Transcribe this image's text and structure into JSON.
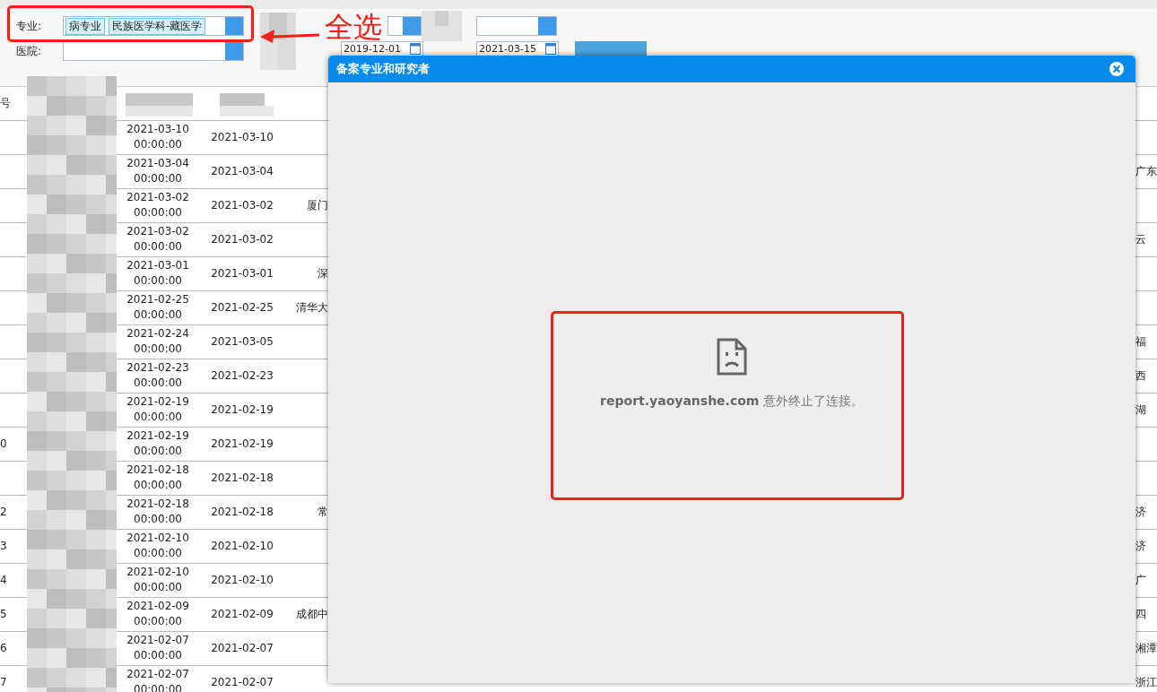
{
  "filters": {
    "major_label": "专业:",
    "major_tags": [
      "病专业",
      "民族医学科-藏医学"
    ],
    "hospital_label": "医院:",
    "date_from": "2019-12-01",
    "date_to": "2021-03-15"
  },
  "annotation": {
    "text": "全选"
  },
  "table": {
    "header_cell": "号",
    "rows": [
      {
        "index": "",
        "created": "2021-03-10 00:00:00",
        "date": "2021-03-10",
        "institution": "",
        "region": ""
      },
      {
        "index": "",
        "created": "2021-03-04 00:00:00",
        "date": "2021-03-04",
        "institution": "",
        "region": "广东"
      },
      {
        "index": "",
        "created": "2021-03-02 00:00:00",
        "date": "2021-03-02",
        "institution": "厦门",
        "region": ""
      },
      {
        "index": "",
        "created": "2021-03-02 00:00:00",
        "date": "2021-03-02",
        "institution": "",
        "region": "云"
      },
      {
        "index": "",
        "created": "2021-03-01 00:00:00",
        "date": "2021-03-01",
        "institution": "深",
        "region": ""
      },
      {
        "index": "",
        "created": "2021-02-25 00:00:00",
        "date": "2021-02-25",
        "institution": "清华大",
        "region": ""
      },
      {
        "index": "",
        "created": "2021-02-24 00:00:00",
        "date": "2021-03-05",
        "institution": "",
        "region": "福"
      },
      {
        "index": "",
        "created": "2021-02-23 00:00:00",
        "date": "2021-02-23",
        "institution": "",
        "region": "西"
      },
      {
        "index": "",
        "created": "2021-02-19 00:00:00",
        "date": "2021-02-19",
        "institution": "",
        "region": "湖"
      },
      {
        "index": "0",
        "created": "2021-02-19 00:00:00",
        "date": "2021-02-19",
        "institution": "",
        "region": ""
      },
      {
        "index": "",
        "created": "2021-02-18 00:00:00",
        "date": "2021-02-18",
        "institution": "",
        "region": ""
      },
      {
        "index": "2",
        "created": "2021-02-18 00:00:00",
        "date": "2021-02-18",
        "institution": "常",
        "region": "济"
      },
      {
        "index": "3",
        "created": "2021-02-10 00:00:00",
        "date": "2021-02-10",
        "institution": "",
        "region": "济"
      },
      {
        "index": "4",
        "created": "2021-02-10 00:00:00",
        "date": "2021-02-10",
        "institution": "",
        "region": "广"
      },
      {
        "index": "5",
        "created": "2021-02-09 00:00:00",
        "date": "2021-02-09",
        "institution": "成都中",
        "region": "四"
      },
      {
        "index": "6",
        "created": "2021-02-07 00:00:00",
        "date": "2021-02-07",
        "institution": "",
        "region": "湘潭"
      },
      {
        "index": "7",
        "created": "2021-02-07 00:00:00",
        "date": "2021-02-07",
        "institution": "",
        "region": "浙江"
      }
    ]
  },
  "dialog": {
    "title": "备案专业和研究者",
    "error_message": "**report.yaoyanshe.com** 意外终止了连接。"
  }
}
